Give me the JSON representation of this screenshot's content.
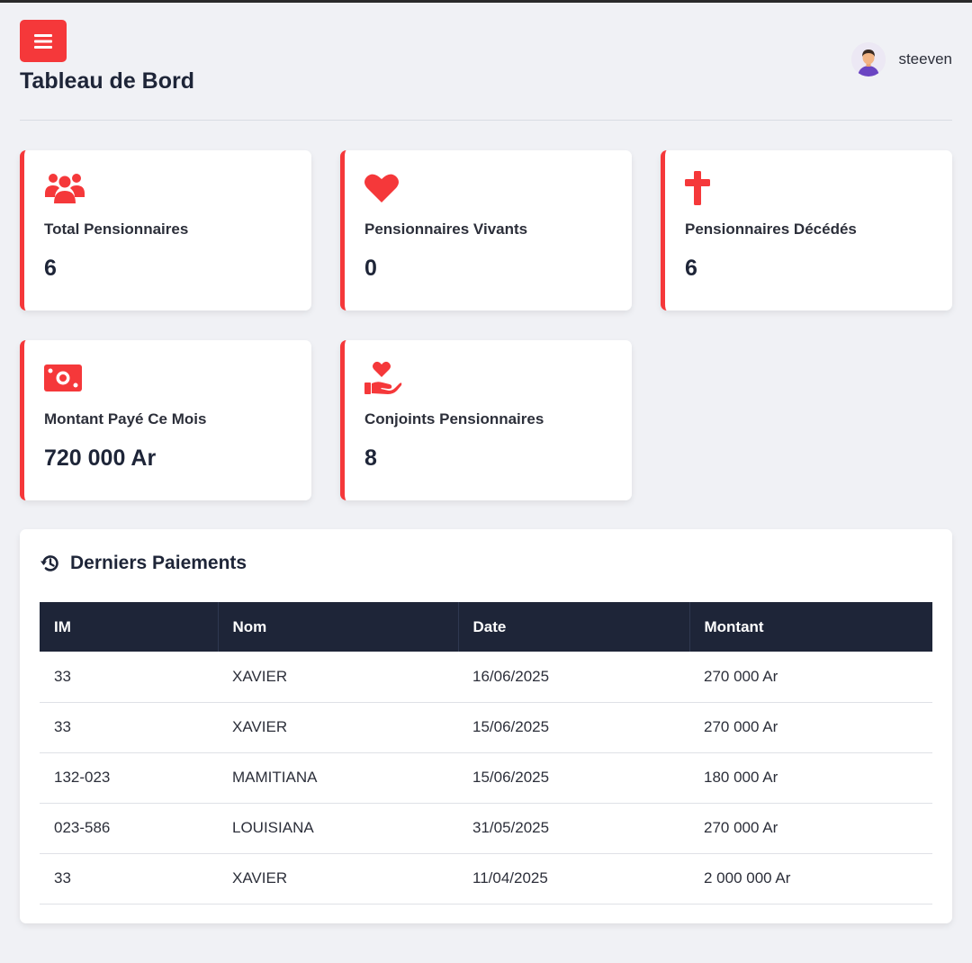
{
  "header": {
    "title": "Tableau de Bord",
    "menu_icon": "bars-icon",
    "user": {
      "name": "steeven",
      "avatar_icon": "user-avatar-icon"
    }
  },
  "cards": [
    {
      "icon": "users-icon",
      "label": "Total Pensionnaires",
      "value": "6"
    },
    {
      "icon": "heart-icon",
      "label": "Pensionnaires Vivants",
      "value": "0"
    },
    {
      "icon": "cross-icon",
      "label": "Pensionnaires Décédés",
      "value": "6"
    },
    {
      "icon": "money-bill-icon",
      "label": "Montant Payé Ce Mois",
      "value": "720 000 Ar"
    },
    {
      "icon": "hand-holding-heart-icon",
      "label": "Conjoints Pensionnaires",
      "value": "8"
    }
  ],
  "payments": {
    "title": "Derniers Paiements",
    "icon": "history-icon",
    "columns": [
      "IM",
      "Nom",
      "Date",
      "Montant"
    ],
    "rows": [
      [
        "33",
        "XAVIER",
        "16/06/2025",
        "270 000 Ar"
      ],
      [
        "33",
        "XAVIER",
        "15/06/2025",
        "270 000 Ar"
      ],
      [
        "132-023",
        "MAMITIANA",
        "15/06/2025",
        "180 000 Ar"
      ],
      [
        "023-586",
        "LOUISIANA",
        "31/05/2025",
        "270 000 Ar"
      ],
      [
        "33",
        "XAVIER",
        "11/04/2025",
        "2 000 000 Ar"
      ]
    ]
  },
  "colors": {
    "accent": "#f5383a",
    "dark": "#1e2538",
    "background": "#f0f1f5"
  }
}
